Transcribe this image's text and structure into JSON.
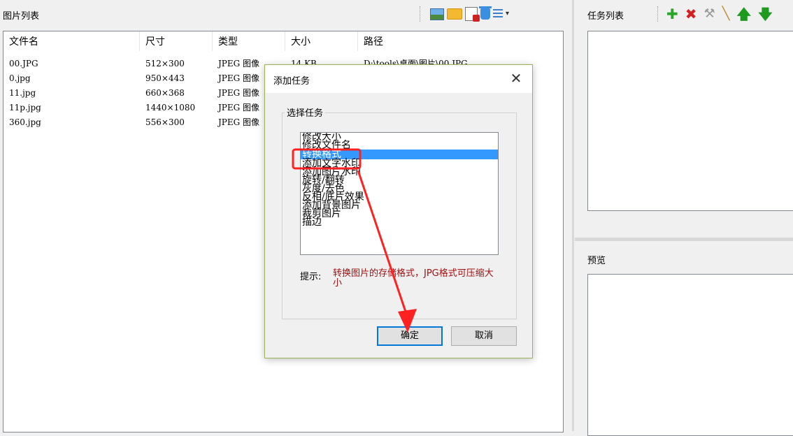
{
  "left": {
    "title": "图片列表",
    "columns": [
      "文件名",
      "尺寸",
      "类型",
      "大小",
      "路径"
    ],
    "files": [
      {
        "name": "00.JPG",
        "size": "512×300",
        "type": "JPEG 图像",
        "filesize": "14 KB",
        "path": "D:\\tools\\桌面\\图片\\00.JPG"
      },
      {
        "name": "0.jpg",
        "size": "950×443",
        "type": "JPEG 图像",
        "filesize": "",
        "path": ""
      },
      {
        "name": "11.jpg",
        "size": "660×368",
        "type": "JPEG 图像",
        "filesize": "",
        "path": ""
      },
      {
        "name": "11p.jpg",
        "size": "1440×1080",
        "type": "JPEG 图像",
        "filesize": "",
        "path": ""
      },
      {
        "name": "360.jpg",
        "size": "556×300",
        "type": "JPEG 图像",
        "filesize": "",
        "path": ""
      }
    ],
    "toolbar_icons": [
      "image-icon",
      "folder-icon",
      "delete-document-icon",
      "trash-icon",
      "list-menu-icon",
      "dropdown-arrow-icon"
    ]
  },
  "right": {
    "task_title": "任务列表",
    "preview_title": "预览",
    "toolbar_icons": [
      "add-icon",
      "delete-icon",
      "wrench-icon",
      "broom-icon",
      "arrow-up-icon",
      "arrow-down-icon"
    ]
  },
  "dialog": {
    "title": "添加任务",
    "close": "✕",
    "group_label": "选择任务",
    "options": [
      "修改大小",
      "修改文件名",
      "转换格式",
      "添加文字水印",
      "添加图片水印",
      "旋转/翻转",
      "灰度/去色",
      "反相/底片效果",
      "添加背景图片",
      "裁剪图片",
      "描边"
    ],
    "selected_index": 2,
    "hint_label": "提示:",
    "hint_text": "转换图片的存储格式，JPG格式可压缩大小",
    "ok": "确定",
    "cancel": "取消"
  },
  "colors": {
    "selection": "#3399ff",
    "annotation": "#ff2020",
    "hint": "#a01010"
  }
}
